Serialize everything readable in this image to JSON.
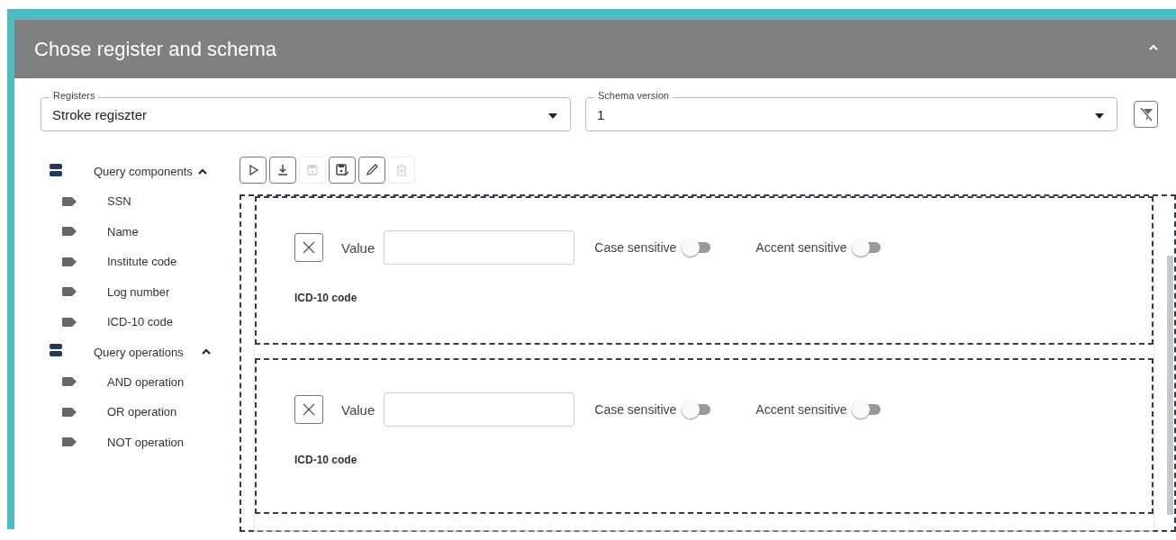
{
  "panel": {
    "title": "Chose register and schema",
    "expanded": true
  },
  "selects": [
    {
      "label": "Registers",
      "value": "Stroke regiszter"
    },
    {
      "label": "Schema version",
      "value": "1"
    }
  ],
  "tree": [
    {
      "label": "Query components",
      "expanded": true,
      "children": [
        {
          "label": "SSN"
        },
        {
          "label": "Name"
        },
        {
          "label": "Institute code"
        },
        {
          "label": "Log number"
        },
        {
          "label": "ICD-10 code"
        }
      ]
    },
    {
      "label": "Query operations",
      "expanded": true,
      "children": [
        {
          "label": "AND operation"
        },
        {
          "label": "OR operation"
        },
        {
          "label": "NOT operation"
        }
      ]
    }
  ],
  "toolbar": [
    {
      "kind": "run",
      "disabled": false
    },
    {
      "kind": "download",
      "disabled": false
    },
    {
      "kind": "save",
      "disabled": true
    },
    {
      "kind": "saveas",
      "disabled": false
    },
    {
      "kind": "edit",
      "disabled": false
    },
    {
      "kind": "delete",
      "disabled": true
    }
  ],
  "conditions": [
    {
      "value_label": "Value",
      "case_label": "Case sensitive",
      "case_on": false,
      "accent_label": "Accent sensitive",
      "accent_on": false,
      "component": "ICD-10 code"
    },
    {
      "value_label": "Value",
      "case_label": "Case sensitive",
      "case_on": false,
      "accent_label": "Accent sensitive",
      "accent_on": false,
      "component": "ICD-10 code"
    }
  ]
}
